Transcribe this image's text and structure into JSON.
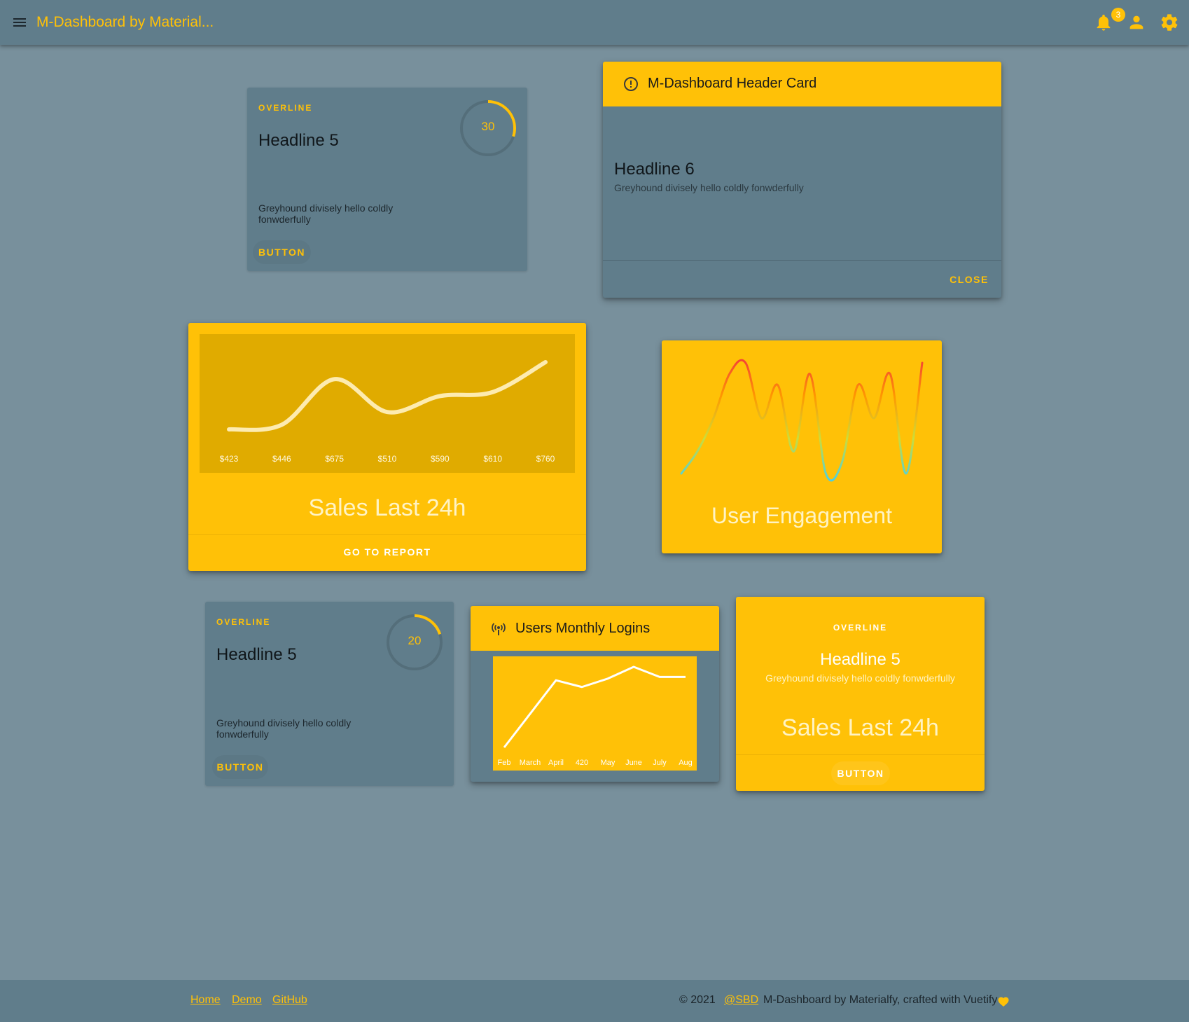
{
  "appbar": {
    "title": "M-Dashboard by Material...",
    "notification_count": "3"
  },
  "card_tl": {
    "overline": "OVERLINE",
    "headline": "Headline 5",
    "text": "Greyhound divisely hello coldly fonwderfully",
    "progress_value": "30",
    "progress_fraction": 0.3,
    "button": "BUTTON"
  },
  "header_card": {
    "title": "M-Dashboard Header Card",
    "headline": "Headline 6",
    "text": "Greyhound divisely hello coldly fonwderfully",
    "close": "CLOSE"
  },
  "sales_card": {
    "title": "Sales Last 24h",
    "action": "GO TO REPORT"
  },
  "engagement_card": {
    "title": "User Engagement"
  },
  "card_bl": {
    "overline": "OVERLINE",
    "headline": "Headline 5",
    "text": "Greyhound divisely hello coldly fonwderfully",
    "progress_value": "20",
    "progress_fraction": 0.2,
    "button": "BUTTON"
  },
  "logins_card": {
    "title": "Users Monthly Logins"
  },
  "card_br": {
    "overline": "OVERLINE",
    "headline": "Headline 5",
    "text": "Greyhound divisely hello coldly fonwderfully",
    "title": "Sales Last 24h",
    "button": "BUTTON"
  },
  "footer": {
    "links": [
      "Home",
      "Demo",
      "GitHub"
    ],
    "copyright": "© 2021",
    "author": "@SBD",
    "credit": "M-Dashboard by Materialfy, crafted with Vuetify"
  },
  "colors": {
    "accent": "#ffc107",
    "primary": "#607d8b",
    "background": "#78909c"
  },
  "chart_data": [
    {
      "type": "line",
      "categories": [
        "$423",
        "$446",
        "$675",
        "$510",
        "$590",
        "$610",
        "$760"
      ],
      "values": [
        423,
        446,
        675,
        510,
        590,
        610,
        760
      ],
      "smooth": true
    },
    {
      "type": "line",
      "gradient": [
        "#4dd0e1",
        "#cddc39",
        "#ff9800",
        "#f44336"
      ],
      "values": [
        0,
        2,
        5,
        9,
        10,
        5,
        8,
        2,
        9,
        0,
        1,
        8,
        5,
        9,
        0,
        10
      ],
      "smooth": true
    },
    {
      "type": "line",
      "categories": [
        "Feb",
        "March",
        "April",
        "420",
        "May",
        "June",
        "July",
        "Aug"
      ],
      "values": [
        150,
        250,
        350,
        330,
        355,
        390,
        360,
        360
      ]
    }
  ]
}
